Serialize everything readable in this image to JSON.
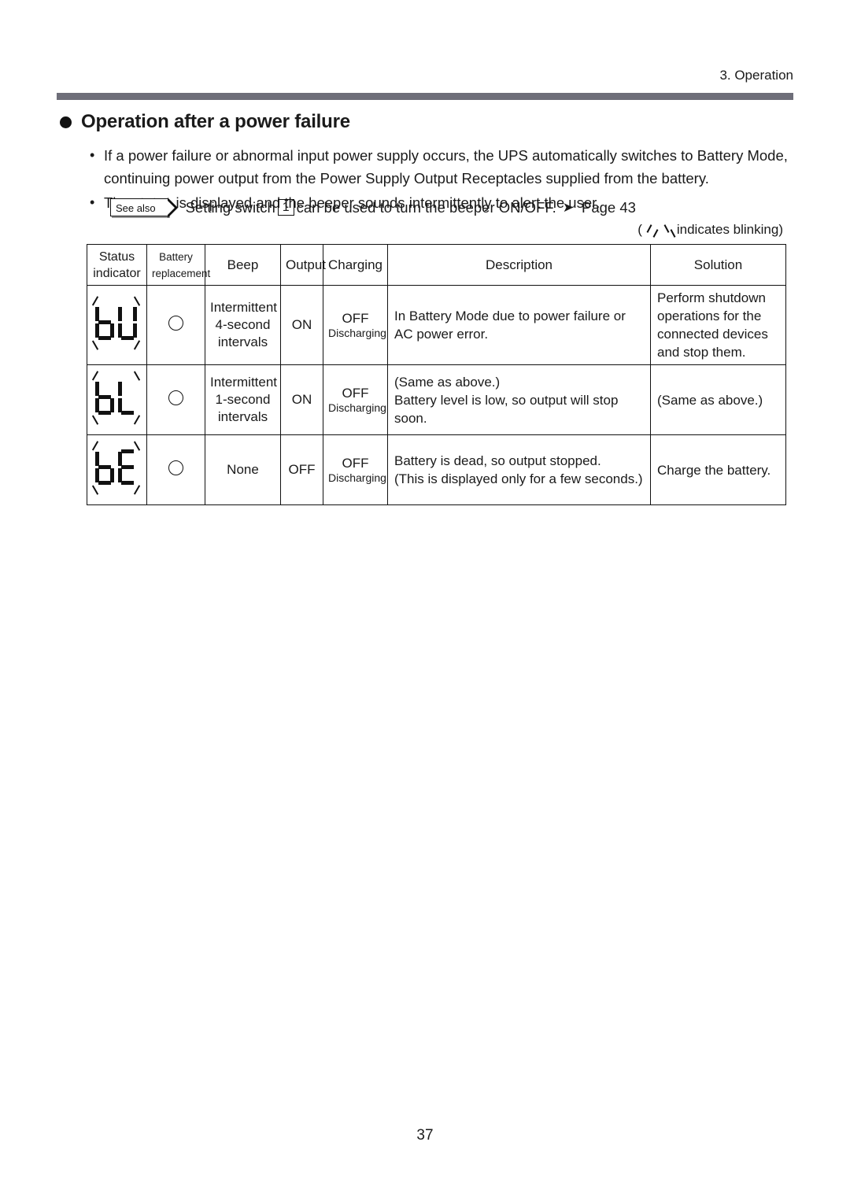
{
  "header": {
    "running_head": "3. Operation"
  },
  "section": {
    "bullet_icon": "filled-circle-bullet",
    "title": "Operation after a power failure"
  },
  "body": {
    "bullets": [
      "If a power failure or abnormal input power supply occurs, the UPS automatically switches to Battery Mode, continuing power output from the Power Supply Output Receptacles supplied from the battery.",
      "The status is displayed and the beeper sounds intermittently to alert the user."
    ],
    "bullet_marker": "•"
  },
  "see_also": {
    "badge_label": "See also",
    "text_before_switch": "Setting switch",
    "switch_number": "1",
    "text_after_switch": "can be used to turn the beeper ON/OFF.",
    "arrow_icon": "➤",
    "page_reference": "Page 43"
  },
  "blink_legend": {
    "open_paren": "(",
    "text": "indicates blinking)"
  },
  "table": {
    "columns": [
      "Status indicator",
      "Battery replacement",
      "Beep",
      "Output",
      "Charging",
      "Description",
      "Solution"
    ],
    "column_labels": {
      "status_line1": "Status",
      "status_line2": "indicator",
      "battery_line1": "Battery",
      "battery_line2": "replacement",
      "beep": "Beep",
      "output": "Output",
      "charging": "Charging",
      "description": "Description",
      "solution": "Solution"
    },
    "rows": [
      {
        "indicator_code": "bU",
        "indicator_blinking": true,
        "battery_replacement": "ring-empty",
        "beep": "Intermittent\n4-second\nintervals",
        "beep_lines": [
          "Intermittent",
          "4-second",
          "intervals"
        ],
        "output": "ON",
        "charging_main": "OFF",
        "charging_sub": "Discharging",
        "description_lines": [
          "In Battery Mode due to power failure or",
          "AC power error."
        ],
        "solution_lines": [
          "Perform shutdown",
          "operations for the",
          "connected devices",
          "and stop them."
        ]
      },
      {
        "indicator_code": "bL",
        "indicator_blinking": true,
        "battery_replacement": "ring-empty",
        "beep": "Intermittent\n1-second\nintervals",
        "beep_lines": [
          "Intermittent",
          "1-second",
          "intervals"
        ],
        "output": "ON",
        "charging_main": "OFF",
        "charging_sub": "Discharging",
        "description_lines": [
          "(Same as above.)",
          "Battery level is low, so output will stop soon."
        ],
        "solution_lines": [
          "(Same as above.)"
        ]
      },
      {
        "indicator_code": "bE",
        "indicator_blinking": true,
        "battery_replacement": "ring-empty",
        "beep": "None",
        "beep_lines": [
          "None"
        ],
        "output": "OFF",
        "charging_main": "OFF",
        "charging_sub": "Discharging",
        "description_lines": [
          "Battery is dead, so output stopped.",
          " (This is displayed only for a few seconds.)"
        ],
        "solution_lines": [
          "Charge the battery."
        ]
      }
    ]
  },
  "footer": {
    "page_number": "37"
  },
  "colors": {
    "rule_bar": "#6e6e79",
    "text": "#1a1a1a",
    "border": "#111111"
  }
}
